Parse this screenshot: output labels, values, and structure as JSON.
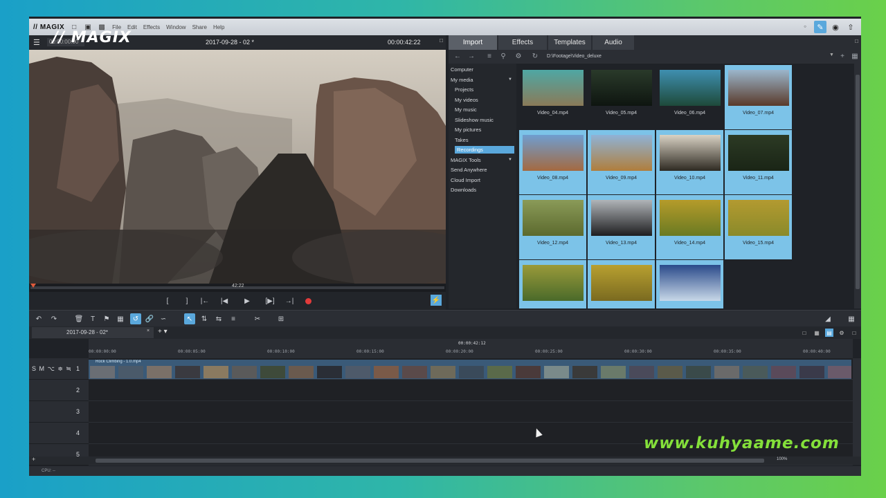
{
  "app": {
    "logo": "// MAGIX",
    "menubar_logo": "// MAGIX",
    "menu": [
      "File",
      "Edit",
      "Effects",
      "Window",
      "Share",
      "Help"
    ]
  },
  "preview": {
    "left_timecode": "00:00:00:00",
    "title": "2017-09-28 - 02 *",
    "right_timecode": "00:00:42:22",
    "scrub_time": "42:22"
  },
  "pool": {
    "tabs": [
      "Import",
      "Effects",
      "Templates",
      "Audio"
    ],
    "active_tab": "Import",
    "path": "D:\\Footage\\Video_deluxe",
    "tree": [
      {
        "label": "Computer",
        "level": 0
      },
      {
        "label": "My media",
        "level": 0,
        "expand": true
      },
      {
        "label": "Projects",
        "level": 1
      },
      {
        "label": "My videos",
        "level": 1
      },
      {
        "label": "My music",
        "level": 1
      },
      {
        "label": "Slideshow music",
        "level": 1
      },
      {
        "label": "My pictures",
        "level": 1
      },
      {
        "label": "Takes",
        "level": 1
      },
      {
        "label": "Recordings",
        "level": 1,
        "selected": true
      },
      {
        "label": "MAGIX Tools",
        "level": 0,
        "expand": true
      },
      {
        "label": "Send Anywhere",
        "level": 0
      },
      {
        "label": "Cloud Import",
        "level": 0
      },
      {
        "label": "Downloads",
        "level": 0
      }
    ],
    "files": [
      {
        "name": "Video_04.mp4",
        "selected": false,
        "c1": "#4fa7a4",
        "c2": "#8a7a58"
      },
      {
        "name": "Video_05.mp4",
        "selected": false,
        "c1": "#2a3a2a",
        "c2": "#0e1510"
      },
      {
        "name": "Video_06.mp4",
        "selected": false,
        "c1": "#3f8fb0",
        "c2": "#1e4a3a"
      },
      {
        "name": "Video_07.mp4",
        "selected": true,
        "c1": "#9bb6cc",
        "c2": "#5a3a2a"
      },
      {
        "name": "Video_08.mp4",
        "selected": true,
        "c1": "#6f9ed0",
        "c2": "#a46a40"
      },
      {
        "name": "Video_09.mp4",
        "selected": true,
        "c1": "#8fb3d6",
        "c2": "#b07e3c"
      },
      {
        "name": "Video_10.mp4",
        "selected": true,
        "c1": "#d9d2c4",
        "c2": "#2e2a22"
      },
      {
        "name": "Video_11.mp4",
        "selected": true,
        "c1": "#2c3a24",
        "c2": "#1a2516"
      },
      {
        "name": "Video_12.mp4",
        "selected": true,
        "c1": "#8a9a58",
        "c2": "#5c6a2e"
      },
      {
        "name": "Video_13.mp4",
        "selected": true,
        "c1": "#b0b4b8",
        "c2": "#1e1e20"
      },
      {
        "name": "Video_14.mp4",
        "selected": true,
        "c1": "#b59b2a",
        "c2": "#6a7a22"
      },
      {
        "name": "Video_15.mp4",
        "selected": true,
        "c1": "#b39a30",
        "c2": "#8a8a2a"
      },
      {
        "name": "",
        "selected": true,
        "c1": "#9a9a3a",
        "c2": "#4a6a2a"
      },
      {
        "name": "",
        "selected": true,
        "c1": "#b8a030",
        "c2": "#7a6a20"
      },
      {
        "name": "",
        "selected": true,
        "c1": "#2a4a8a",
        "c2": "#c8d8e8"
      }
    ]
  },
  "timeline": {
    "tab_label": "2017-09-28 - 02*",
    "position": "00:00:42:12",
    "ticks": [
      "00:00:00:00",
      "00:00:05:00",
      "00:00:10:00",
      "00:00:15:00",
      "00:00:20:00",
      "00:00:25:00",
      "00:00:30:00",
      "00:00:35:00",
      "00:00:40:00"
    ],
    "tracks": [
      "1",
      "2",
      "3",
      "4",
      "5"
    ],
    "track_controls": "S M ⌥ ≑ ≒",
    "clip_name": "Rock Climbing - 1.0.mp4",
    "zoom": "100%"
  },
  "status": {
    "cpu": "CPU: --"
  },
  "watermark": "www.kuhyaame.com",
  "colors": {
    "accent": "#5aa8dc",
    "selection": "#7cc3e8",
    "record": "#e23b3b",
    "watermark": "#84e03a"
  }
}
